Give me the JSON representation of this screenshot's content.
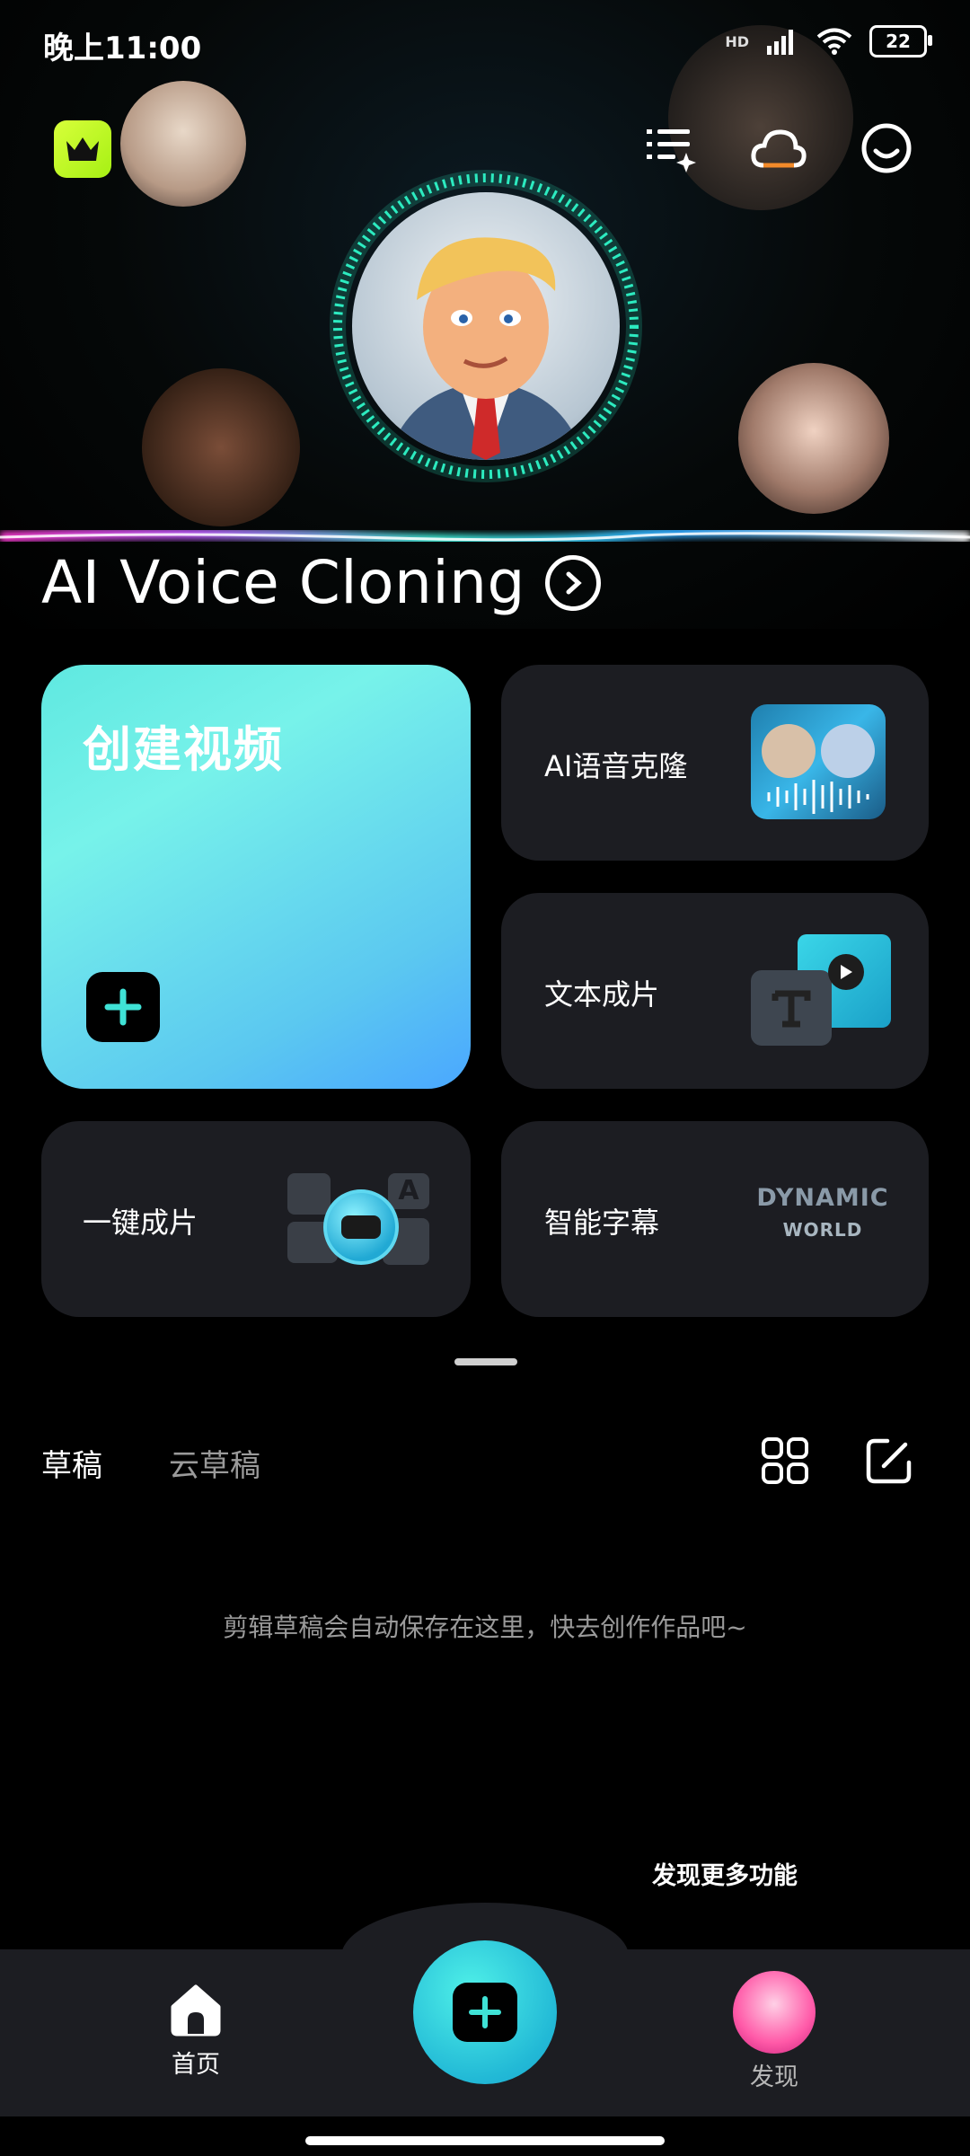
{
  "status_bar": {
    "time": "晚上11:00",
    "network": "HD",
    "battery": "22"
  },
  "hero": {
    "title": "AI Voice Cloning",
    "accent_colors": [
      "#3ff0d8",
      "#ff3bd4",
      "#2fa8ff"
    ]
  },
  "header_icons": [
    "crown-icon",
    "list-sparkle-icon",
    "cloud-icon",
    "smiley-icon"
  ],
  "create_card": {
    "title": "创建视频",
    "gradient": [
      "#5fe8e0",
      "#4aa7ff"
    ]
  },
  "feature_cards": [
    {
      "label": "AI语音克隆",
      "thumb": "voice-clone-thumbnail"
    },
    {
      "label": "文本成片",
      "thumb": "text-to-video-thumbnail"
    },
    {
      "label": "一键成片",
      "thumb": "one-click-video-thumbnail"
    },
    {
      "label": "智能字幕",
      "thumb": "smart-subtitle-thumbnail",
      "thumb_text": [
        "DYNAMIC",
        "WORLD"
      ]
    }
  ],
  "drafts": {
    "tabs": [
      "草稿",
      "云草稿"
    ],
    "active_tab": "草稿",
    "empty_message": "剪辑草稿会自动保存在这里，快去创作作品吧~"
  },
  "discover_more": "发现更多功能",
  "bottom_nav": {
    "items": [
      {
        "label": "首页",
        "icon": "home-icon"
      },
      {
        "label": "发现",
        "icon": "discover-avatar"
      }
    ]
  }
}
